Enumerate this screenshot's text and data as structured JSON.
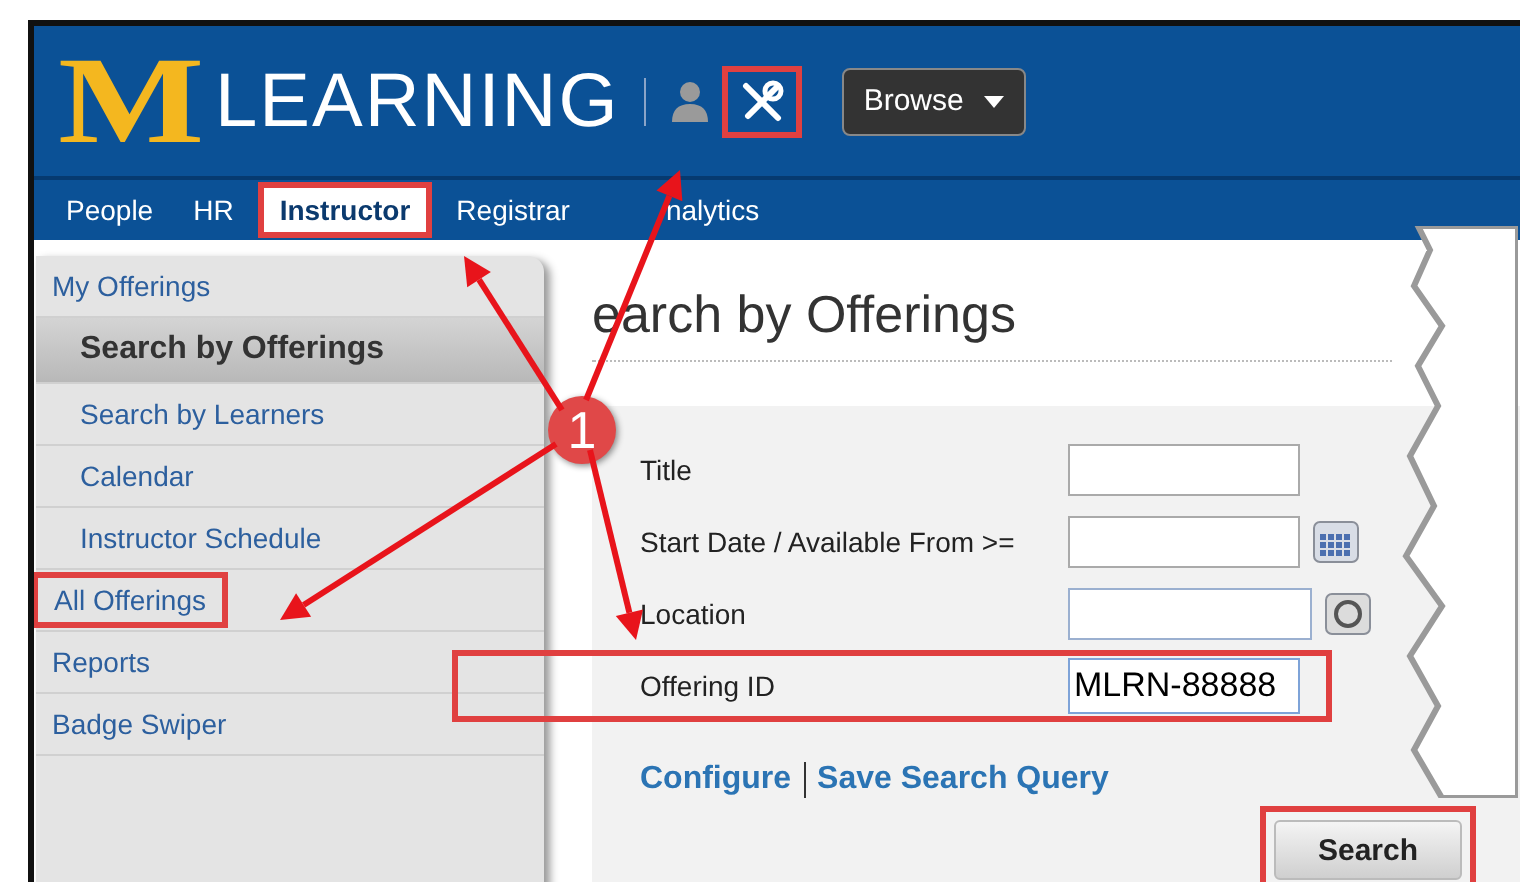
{
  "header": {
    "logo_mark": "M",
    "logo_text": "LEARNING",
    "tools_highlighted": true,
    "browse": "Browse"
  },
  "nav": [
    {
      "label": "People",
      "selected": false
    },
    {
      "label": "HR",
      "selected": false
    },
    {
      "label": "Instructor",
      "selected": true,
      "highlighted": true
    },
    {
      "label": "Registrar",
      "selected": false
    },
    {
      "label": "nalytics",
      "selected": false
    }
  ],
  "sidebar": {
    "items": [
      {
        "label": "My Offerings",
        "selected": false,
        "children": [
          {
            "label": "Search by Offerings",
            "selected": true
          },
          {
            "label": "Search by Learners",
            "selected": false
          },
          {
            "label": "Calendar",
            "selected": false
          },
          {
            "label": "Instructor Schedule",
            "selected": false
          }
        ]
      },
      {
        "label": "All Offerings",
        "selected": false,
        "highlighted": true
      },
      {
        "label": "Reports",
        "selected": false
      },
      {
        "label": "Badge Swiper",
        "selected": false
      }
    ]
  },
  "page_title": "earch by Offerings",
  "form": {
    "fields": [
      {
        "label": "Title",
        "kind": "text"
      },
      {
        "label": "Start Date / Available From >=",
        "kind": "date"
      },
      {
        "label": "Location",
        "kind": "lookup"
      },
      {
        "label": "Offering ID",
        "kind": "text",
        "value": "MLRN-88888",
        "highlighted": true
      }
    ],
    "links": [
      "Configure",
      "Save Search Query"
    ],
    "search_button": {
      "label": "Search",
      "highlighted": true
    }
  },
  "annotations": {
    "callout": "1"
  }
}
